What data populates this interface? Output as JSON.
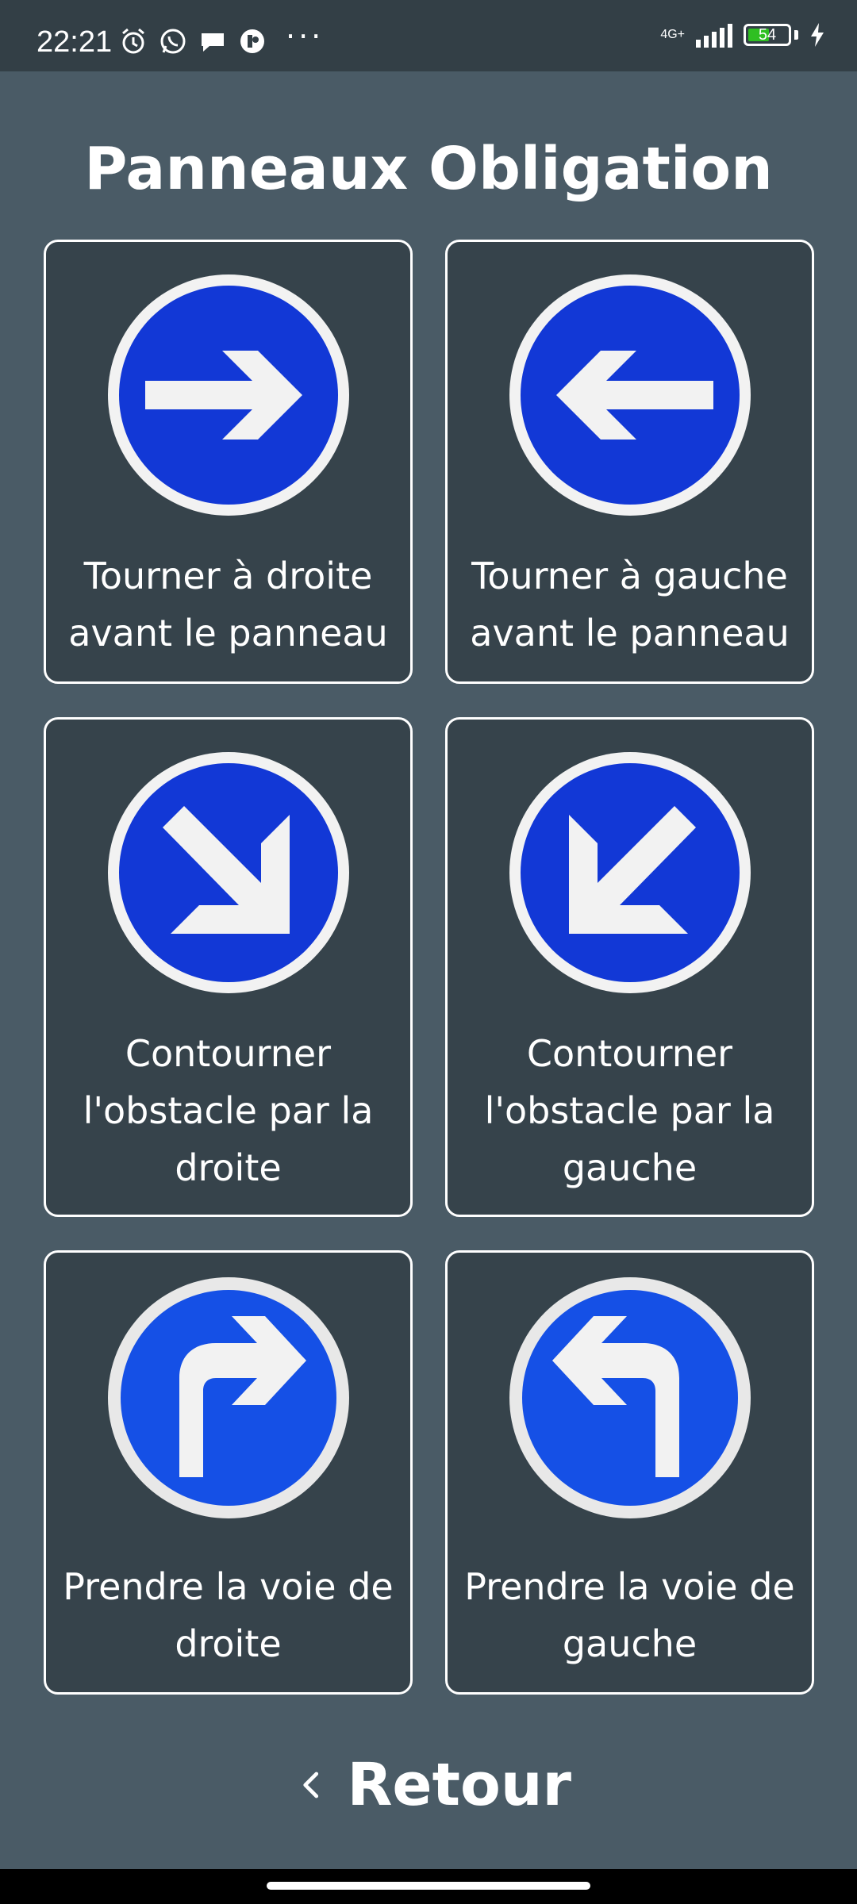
{
  "status_bar": {
    "time": "22:21",
    "network": "4G+",
    "battery": "54",
    "battery_level_percent": 54,
    "icons": [
      "alarm-icon",
      "whatsapp-icon",
      "chat-icon",
      "app-icon",
      "more-icon",
      "signal-icon",
      "battery-icon",
      "charging-icon"
    ]
  },
  "title": "Panneaux Obligation",
  "signs": [
    {
      "label": "Tourner à droite\navant le panneau",
      "icon": "arrow-right-sign-icon"
    },
    {
      "label": "Tourner à gauche\navant le panneau",
      "icon": "arrow-left-sign-icon"
    },
    {
      "label": "Contourner\nl'obstacle par la\ndroite",
      "icon": "arrow-down-right-sign-icon"
    },
    {
      "label": "Contourner\nl'obstacle par la\ngauche",
      "icon": "arrow-down-left-sign-icon"
    },
    {
      "label": "Prendre la voie de\ndroite",
      "icon": "turn-right-sign-icon"
    },
    {
      "label": "Prendre la voie de\ngauche",
      "icon": "turn-left-sign-icon"
    }
  ],
  "back": {
    "label": "Retour",
    "icon": "chevron-left-icon"
  },
  "colors": {
    "background": "#4a5b66",
    "card": "#36434b",
    "sign_blue": "#1238d6",
    "sign_border": "#f2f2f2",
    "battery_green": "#2fbf22"
  }
}
